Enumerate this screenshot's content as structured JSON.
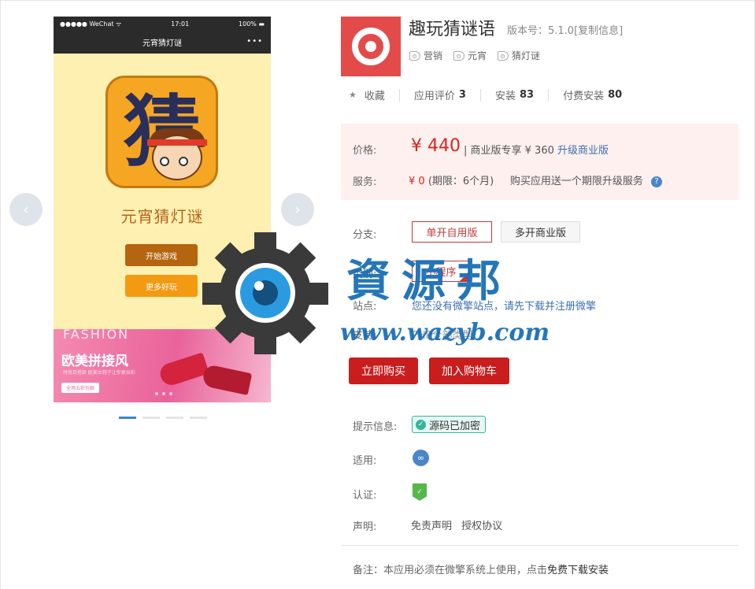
{
  "phone": {
    "status_left": "●●●●● WeChat ᯤ",
    "status_time": "17:01",
    "status_right": "100% ▬",
    "nav_title": "元宵猜灯谜",
    "nav_dots": "•••",
    "icon_char": "猜",
    "game_title": "元宵猜灯谜",
    "btn_start": "开始游戏",
    "btn_more": "更多好玩",
    "banner_fashion": "FASHION",
    "banner_title": "欧美拼接风",
    "banner_small": "时尚百搭款  欧美女鞋子让你更出彩",
    "banner_pill": "全场五折包邮"
  },
  "carousel": {
    "prev": "‹",
    "next": "›"
  },
  "app": {
    "title": "趣玩猜谜语",
    "version": "版本号：5.1.0[复制信息]",
    "tags": [
      "营销",
      "元宵",
      "猜灯谜"
    ],
    "favorite": "收藏",
    "rating_label": "应用评价",
    "rating_value": "3",
    "install_label": "安装",
    "install_value": "83",
    "paid_label": "付费安装",
    "paid_value": "80"
  },
  "pricing": {
    "price_label": "价格:",
    "price": "¥ 440",
    "price_sub": "| 商业版专享 ¥ 360",
    "upgrade": "升级商业版",
    "service_label": "服务:",
    "service_price": "¥ 0",
    "service_term": "(期限：6个月)",
    "service_desc": "购买应用送一个期限升级服务",
    "help": "?"
  },
  "options": {
    "branch_label": "分支:",
    "branch_1": "单开自用版",
    "branch_2": "多开商业版",
    "type_label": "类别:",
    "type_1": "小程序",
    "site_label": "站点:",
    "site_text": "您还没有微擎站点，请先下载并注册微擎",
    "support_label": "支持:",
    "support_text": "PHP全部类型"
  },
  "actions": {
    "buy": "立即购买",
    "cart": "加入购物车"
  },
  "info": {
    "hint_label": "提示信息:",
    "hint_badge": "源码已加密",
    "apply_label": "适用:",
    "cert_label": "认证:",
    "decl_label": "声明:",
    "decl_1": "免责声明",
    "decl_2": "授权协议",
    "note_prefix": "备注：本应用必须在微擎系统上使用，点击",
    "note_link": "免费下载安装"
  },
  "watermark": {
    "text": "資源邦",
    "url": "www.wazyb.com"
  },
  "colors": {
    "accent": "#c91e1e",
    "link": "#3d6fb0",
    "price": "#d9251e",
    "pricebox": "#fdf0ee"
  }
}
